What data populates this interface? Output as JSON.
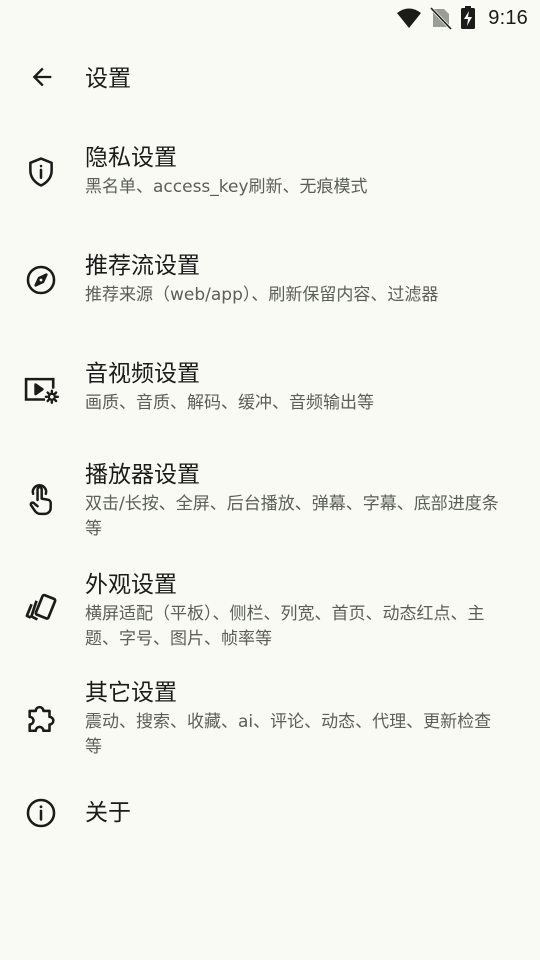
{
  "status_bar": {
    "time": "9:16",
    "icons": [
      "wifi-icon",
      "no-sim-icon",
      "battery-charging-icon"
    ]
  },
  "app_bar": {
    "back_icon": "arrow-back-icon",
    "title": "设置"
  },
  "settings": [
    {
      "icon": "shield-info-icon",
      "label": "隐私设置",
      "desc": "黑名单、access_key刷新、无痕模式"
    },
    {
      "icon": "compass-icon",
      "label": "推荐流设置",
      "desc": "推荐来源（web/app）、刷新保留内容、过滤器"
    },
    {
      "icon": "video-settings-icon",
      "label": "音视频设置",
      "desc": "画质、音质、解码、缓冲、音频输出等"
    },
    {
      "icon": "touch-hand-icon",
      "label": "播放器设置",
      "desc": "双击/长按、全屏、后台播放、弹幕、字幕、底部进度条等"
    },
    {
      "icon": "cards-icon",
      "label": "外观设置",
      "desc": "横屏适配（平板）、侧栏、列宽、首页、动态红点、主题、字号、图片、帧率等"
    },
    {
      "icon": "puzzle-icon",
      "label": "其它设置",
      "desc": "震动、搜索、收藏、ai、评论、动态、代理、更新检查等"
    },
    {
      "icon": "info-icon",
      "label": "关于",
      "desc": ""
    }
  ],
  "colors": {
    "background": "#f8faf3",
    "text_primary": "#1b1c19",
    "text_secondary": "#5c5f58"
  }
}
